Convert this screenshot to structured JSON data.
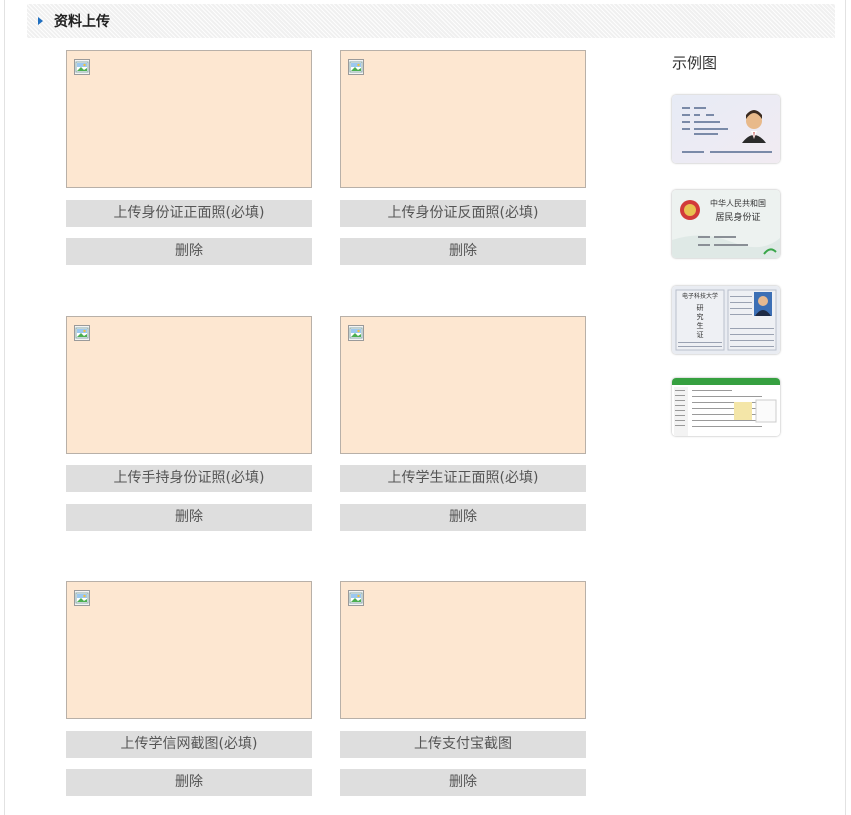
{
  "section": {
    "title": "资料上传"
  },
  "uploads": [
    {
      "upload_label": "上传身份证正面照(必填)",
      "delete_label": "删除"
    },
    {
      "upload_label": "上传身份证反面照(必填)",
      "delete_label": "删除"
    },
    {
      "upload_label": "上传手持身份证照(必填)",
      "delete_label": "删除"
    },
    {
      "upload_label": "上传学生证正面照(必填)",
      "delete_label": "删除"
    },
    {
      "upload_label": "上传学信网截图(必填)",
      "delete_label": "删除"
    },
    {
      "upload_label": "上传支付宝截图",
      "delete_label": "删除"
    }
  ],
  "samples": {
    "title": "示例图",
    "id_back_text": {
      "line1": "中华人民共和国",
      "line2": "居民身份证"
    },
    "student_card_text": {
      "school": "电子科技大学",
      "chars": [
        "研",
        "究",
        "生",
        "证"
      ]
    }
  },
  "colors": {
    "upload_box_bg": "#fde7d1",
    "button_bg": "#dedede",
    "header_arrow": "#1f6fc0"
  }
}
